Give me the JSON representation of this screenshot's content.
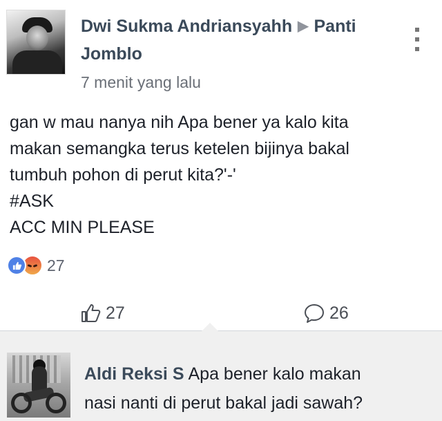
{
  "post": {
    "author": "Dwi Sukma Andriansyahh",
    "arrow_icon": "right-arrow-icon",
    "group": "Panti",
    "group_line2": "Jomblo",
    "timestamp": "7 menit yang lalu",
    "text_lines": [
      "gan w mau nanya nih Apa bener ya kalo kita",
      "makan semangka terus ketelen bijinya bakal",
      "tumbuh pohon di perut kita?'-'",
      "#ASK",
      "ACC MIN PLEASE"
    ],
    "reactions": {
      "icons": [
        "like-reaction-icon",
        "angry-reaction-icon"
      ],
      "count": "27"
    }
  },
  "actions": {
    "like_count": "27",
    "comment_count": "26"
  },
  "comment": {
    "author": "Aldi Reksi S",
    "line1": "Apa bener kalo makan",
    "line2": "nasi nanti di perut bakal jadi sawah?"
  },
  "colors": {
    "author_text": "#3b4a5a",
    "timestamp_text": "#6a6f77",
    "like_blue": "#4f81e6",
    "comment_bg": "#f0f0f0"
  }
}
